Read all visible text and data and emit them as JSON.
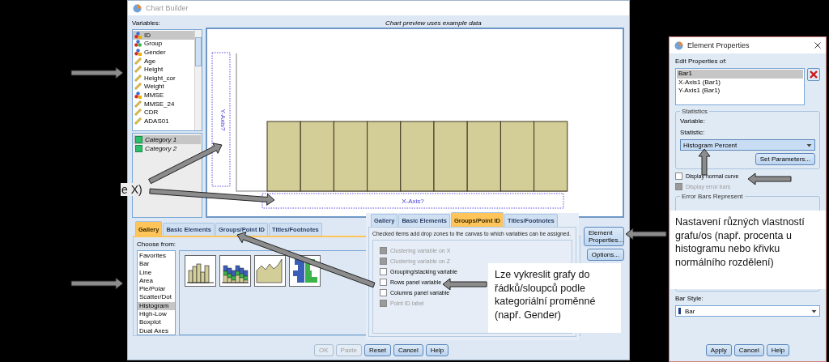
{
  "chart_builder": {
    "title": "Chart Builder",
    "variables_label": "Variables:",
    "variables": [
      {
        "name": "ID",
        "kind": "string",
        "selected": true
      },
      {
        "name": "Group",
        "kind": "nominal",
        "selected": false
      },
      {
        "name": "Gender",
        "kind": "string",
        "selected": false
      },
      {
        "name": "Age",
        "kind": "scale",
        "selected": false
      },
      {
        "name": "Height",
        "kind": "scale",
        "selected": false
      },
      {
        "name": "Height_cor",
        "kind": "scale",
        "selected": false
      },
      {
        "name": "Weight",
        "kind": "scale",
        "selected": false
      },
      {
        "name": "MMSE",
        "kind": "string",
        "selected": false
      },
      {
        "name": "MMSE_24",
        "kind": "scale",
        "selected": false
      },
      {
        "name": "CDR",
        "kind": "scale",
        "selected": false
      },
      {
        "name": "ADAS01",
        "kind": "scale",
        "selected": false
      }
    ],
    "categories": [
      {
        "label": "Category 1",
        "selected": true
      },
      {
        "label": "Category 2",
        "selected": false
      }
    ],
    "preview_caption": "Chart preview uses example data",
    "y_axis_zone": "Y-Axis?",
    "x_axis_zone": "X-Axis?",
    "tabs": [
      {
        "label": "Gallery",
        "selected": true
      },
      {
        "label": "Basic Elements",
        "selected": false
      },
      {
        "label": "Groups/Point ID",
        "selected": false
      },
      {
        "label": "Titles/Footnotes",
        "selected": false
      }
    ],
    "choose_from_label": "Choose from:",
    "chart_types": [
      {
        "label": "Favorites",
        "selected": false
      },
      {
        "label": "Bar",
        "selected": false
      },
      {
        "label": "Line",
        "selected": false
      },
      {
        "label": "Area",
        "selected": false
      },
      {
        "label": "Pie/Polar",
        "selected": false
      },
      {
        "label": "Scatter/Dot",
        "selected": false
      },
      {
        "label": "Histogram",
        "selected": true
      },
      {
        "label": "High-Low",
        "selected": false
      },
      {
        "label": "Boxplot",
        "selected": false
      },
      {
        "label": "Dual Axes",
        "selected": false
      }
    ],
    "side_buttons": [
      "Element Properties...",
      "Options..."
    ],
    "footer_buttons": [
      {
        "label": "OK",
        "disabled": true
      },
      {
        "label": "Paste",
        "disabled": true
      },
      {
        "label": "Reset",
        "disabled": false
      },
      {
        "label": "Cancel",
        "disabled": false
      },
      {
        "label": "Help",
        "disabled": false
      }
    ]
  },
  "groups_panel": {
    "tabs": [
      {
        "label": "Gallery",
        "selected": false
      },
      {
        "label": "Basic Elements",
        "selected": false
      },
      {
        "label": "Groups/Point ID",
        "selected": true
      },
      {
        "label": "Titles/Footnotes",
        "selected": false
      }
    ],
    "hint": "Checked items add drop zones to the canvas to which variables can be assigned.",
    "options": [
      {
        "label": "Clustering variable on X",
        "checked": false,
        "disabled": true
      },
      {
        "label": "Clustering variable on Z",
        "checked": false,
        "disabled": true
      },
      {
        "label": "Grouping/stacking variable",
        "checked": false,
        "disabled": false
      },
      {
        "label": "Rows panel variable",
        "checked": false,
        "disabled": false
      },
      {
        "label": "Columns panel variable",
        "checked": false,
        "disabled": false
      },
      {
        "label": "Point ID label",
        "checked": false,
        "disabled": true
      }
    ]
  },
  "element_properties": {
    "title": "Element Properties",
    "edit_label": "Edit Properties of:",
    "elements": [
      {
        "label": "Bar1",
        "selected": true
      },
      {
        "label": "X-Axis1 (Bar1)",
        "selected": false
      },
      {
        "label": "Y-Axis1 (Bar1)",
        "selected": false
      }
    ],
    "statistics_group": "Statistics",
    "variable_label": "Variable:",
    "statistic_label": "Statistic:",
    "statistic_value": "Histogram Percent",
    "set_parameters_button": "Set Parameters...",
    "checks": [
      {
        "label": "Display normal curve",
        "checked": false,
        "disabled": false
      },
      {
        "label": "Display error bars",
        "checked": false,
        "disabled": true
      }
    ],
    "error_bars_group": "Error Bars Represent",
    "bar_style_label": "Bar Style:",
    "bar_style_value": "Bar",
    "buttons": [
      "Apply",
      "Cancel",
      "Help"
    ]
  },
  "annotations": {
    "cut_text": "e X)",
    "callouts": [
      "Lze vykreslit grafy do řádků/sloupců podle kategoriální proměnné (např. Gender)",
      "Nastavení různých vlastností grafu/os (např. procenta u histogramu nebo křivku normálního rozdělení)"
    ]
  }
}
